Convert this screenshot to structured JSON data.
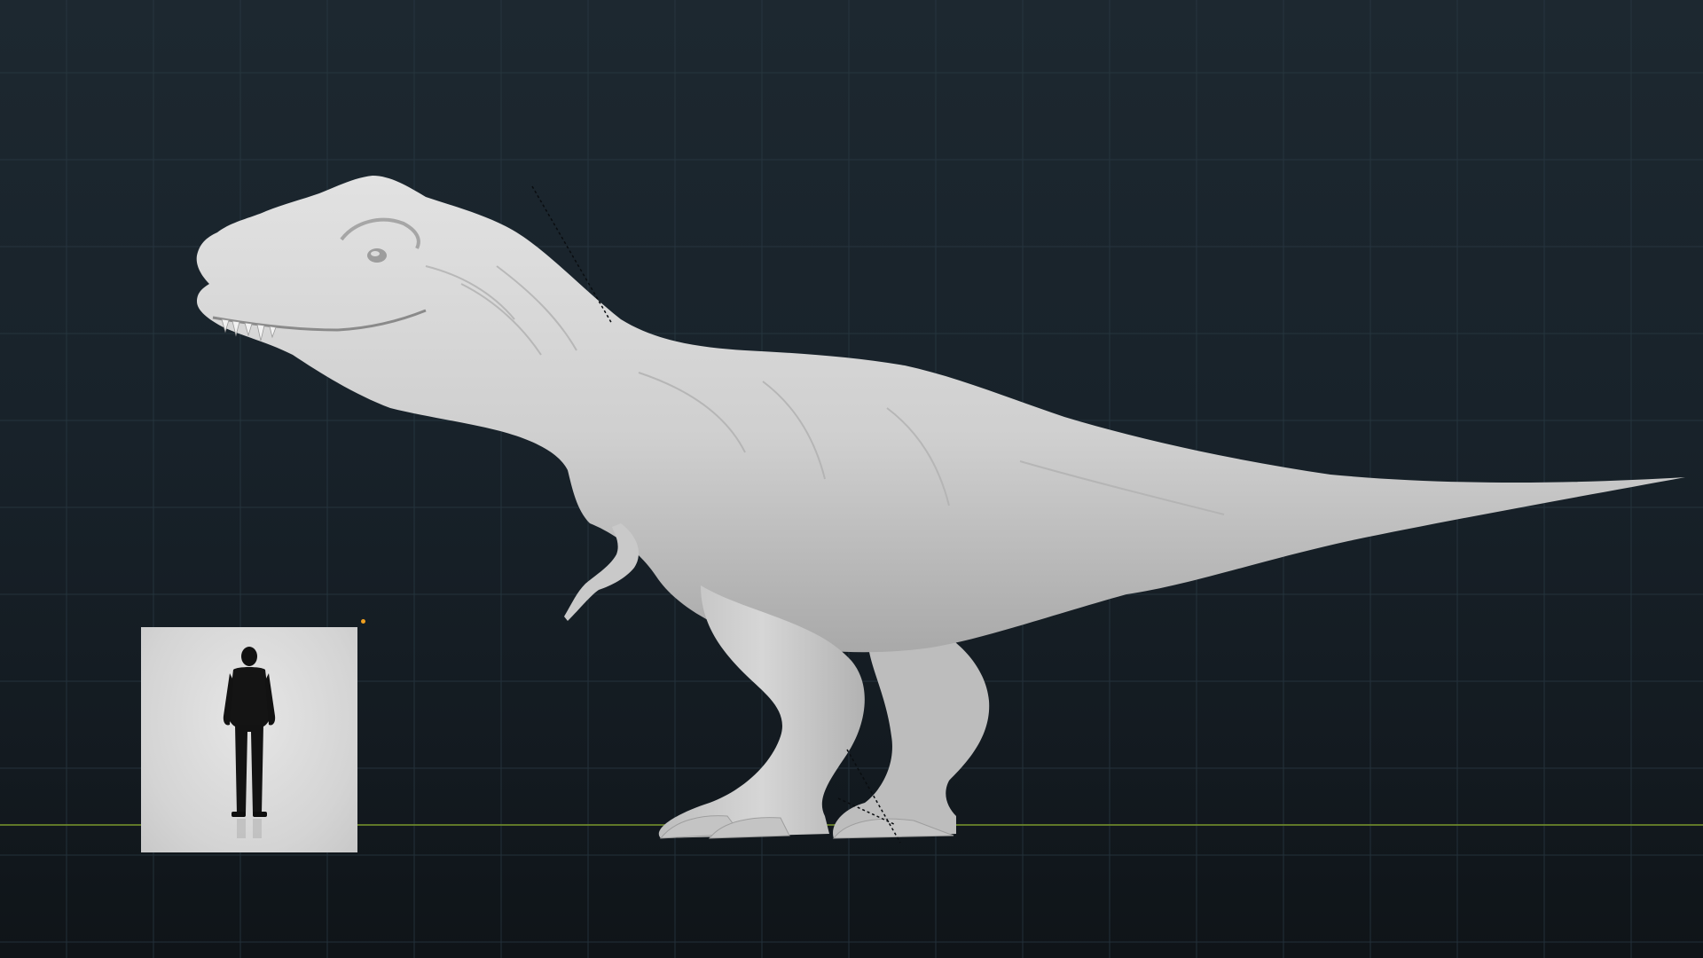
{
  "viewport": {
    "background_color": "#18222a",
    "grid_color": "#2a3a44",
    "ground_line_color": "#6e8a2a",
    "model_color": "#d2d2d2",
    "origin_marker_color": "#f0a020"
  },
  "scene": {
    "main_model": "tyrannosaurus-rex-sculpt",
    "reference_image": "human-silhouette-scale-reference",
    "annotations": [
      "dashed-measure-line-neck",
      "dashed-measure-line-ankle"
    ]
  }
}
